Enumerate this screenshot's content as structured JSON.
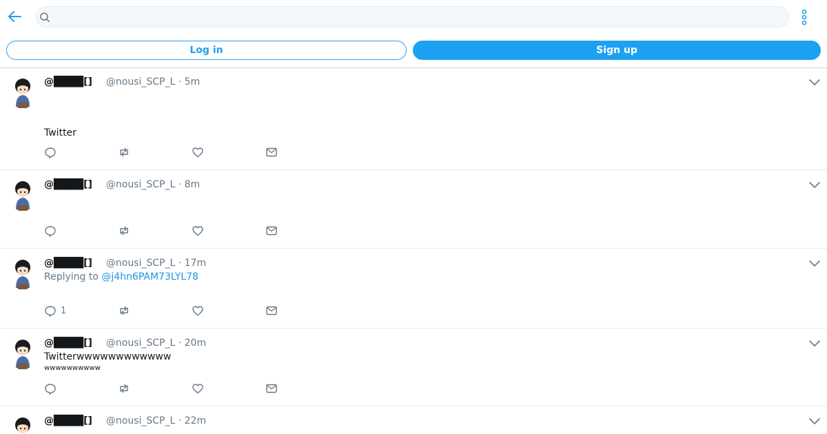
{
  "header": {
    "search_placeholder": "",
    "back_icon": "arrow-left-icon",
    "more_icon": "more-vertical-icon"
  },
  "auth": {
    "login_label": "Log in",
    "signup_label": "Sign up"
  },
  "colors": {
    "accent": "#1da1f2",
    "muted": "#657786",
    "link": "#1b95e0",
    "divider": "#e6ecf0"
  },
  "tweets": [
    {
      "name": "@████[]",
      "meta": "@nousi_SCP_L · 5m",
      "text": "Twitter",
      "reply_count": ""
    },
    {
      "name": "@████[]",
      "meta": "@nousi_SCP_L · 8m",
      "reply_count": ""
    },
    {
      "name": "@████[]",
      "meta": "@nousi_SCP_L · 17m",
      "replying_label": "Replying to",
      "replying_to": "@j4hn6PAM73LYL78",
      "reply_count": "1"
    },
    {
      "name": "@████[]",
      "meta": "@nousi_SCP_L · 20m",
      "text": "Twitterwwwwwwwwwwww",
      "text2": "wwwwwwwwww",
      "reply_count": ""
    },
    {
      "name": "@████[]",
      "meta": "@nousi_SCP_L · 22m"
    }
  ]
}
